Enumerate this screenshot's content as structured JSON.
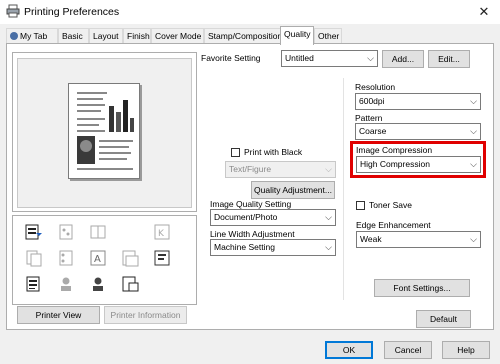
{
  "window": {
    "title": "Printing Preferences",
    "close_glyph": "✕"
  },
  "tabs": [
    {
      "label": "My Tab"
    },
    {
      "label": "Basic"
    },
    {
      "label": "Layout"
    },
    {
      "label": "Finish"
    },
    {
      "label": "Cover Mode"
    },
    {
      "label": "Stamp/Composition"
    },
    {
      "label": "Quality"
    },
    {
      "label": "Other"
    }
  ],
  "active_tab": "Quality",
  "favorite": {
    "label": "Favorite Setting",
    "value": "Untitled",
    "add": "Add...",
    "edit": "Edit..."
  },
  "print_with_black": {
    "label": "Print with Black",
    "checked": false
  },
  "text_figure": {
    "value": "Text/Figure"
  },
  "quality_adjustment": {
    "label": "Quality Adjustment..."
  },
  "image_quality": {
    "label": "Image Quality Setting",
    "value": "Document/Photo"
  },
  "line_width": {
    "label": "Line Width Adjustment",
    "value": "Machine Setting"
  },
  "resolution": {
    "label": "Resolution",
    "value": "600dpi"
  },
  "pattern": {
    "label": "Pattern",
    "value": "Coarse"
  },
  "image_compression": {
    "label": "Image Compression",
    "value": "High Compression"
  },
  "toner_save": {
    "label": "Toner Save",
    "checked": false
  },
  "edge_enhancement": {
    "label": "Edge Enhancement",
    "value": "Weak"
  },
  "font_settings": {
    "label": "Font Settings..."
  },
  "default_btn": {
    "label": "Default"
  },
  "printer_view": {
    "label": "Printer View"
  },
  "printer_information": {
    "label": "Printer Information"
  },
  "dialog_buttons": {
    "ok": "OK",
    "cancel": "Cancel",
    "help": "Help"
  },
  "colors": {
    "highlight": "#e00000",
    "focus_blue": "#0078d7"
  }
}
